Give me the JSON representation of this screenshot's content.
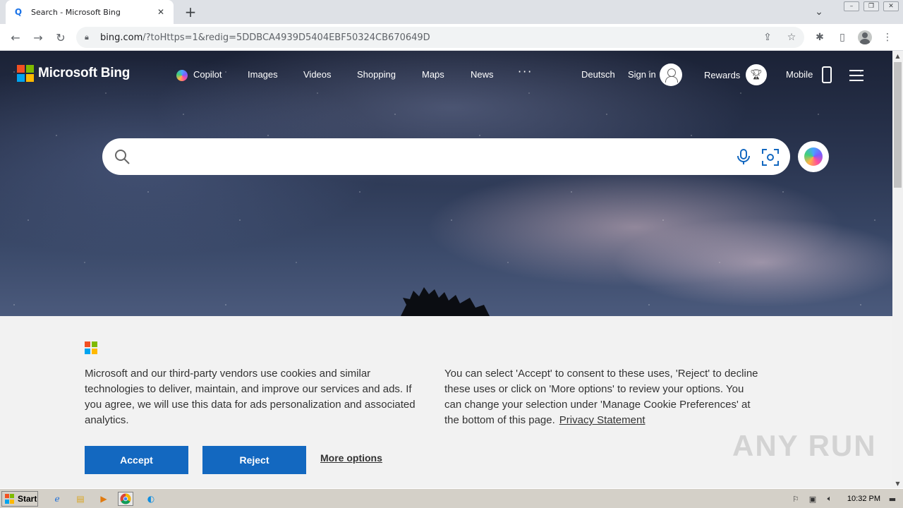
{
  "browser": {
    "tab_title": "Search - Microsoft Bing",
    "url_host": "bing.com",
    "url_path": "/?toHttps=1&redig=5DDBCA4939D5404EBF50324CB670649D"
  },
  "bing": {
    "brand": "Microsoft Bing",
    "nav": {
      "copilot": "Copilot",
      "images": "Images",
      "videos": "Videos",
      "shopping": "Shopping",
      "maps": "Maps",
      "news": "News",
      "more": "···",
      "language": "Deutsch",
      "sign_in": "Sign in",
      "rewards": "Rewards",
      "mobile": "Mobile"
    },
    "search": {
      "value": "",
      "placeholder": ""
    }
  },
  "cookie": {
    "left_text": "Microsoft and our third-party vendors use cookies and similar technologies to deliver, maintain, and improve our services and ads. If you agree, we will use this data for ads personalization and associated analytics.",
    "right_text": "You can select 'Accept' to consent to these uses, 'Reject' to decline these uses or click on 'More options' to review your options. You can change your selection under 'Manage Cookie Preferences' at the bottom of this page.",
    "privacy_link": "Privacy Statement",
    "accept": "Accept",
    "reject": "Reject",
    "more_options": "More options"
  },
  "watermark": "ANY RUN",
  "taskbar": {
    "start": "Start",
    "clock": "10:32 PM"
  },
  "colors": {
    "ms_red": "#f25022",
    "ms_green": "#7fba00",
    "ms_blue": "#00a4ef",
    "ms_yellow": "#ffb900",
    "button_blue": "#1368c0"
  }
}
